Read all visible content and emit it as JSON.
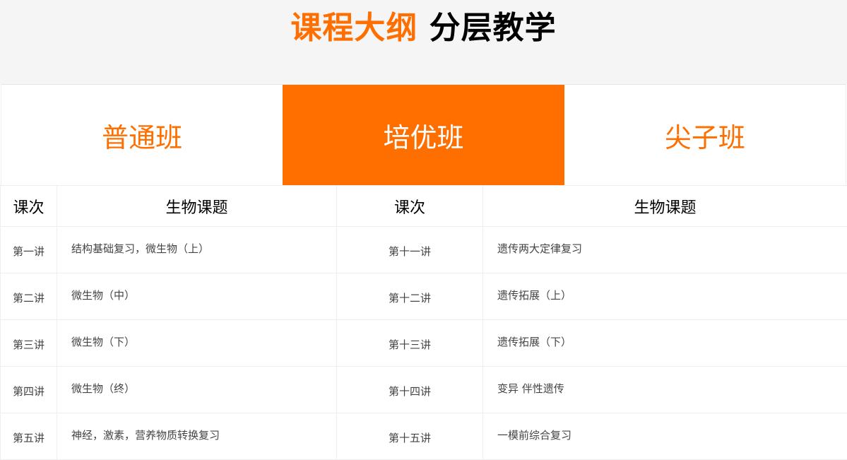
{
  "header": {
    "title_accent": "课程大纲",
    "title_rest": "分层教学"
  },
  "tabs": [
    {
      "label": "普通班",
      "active": false
    },
    {
      "label": "培优班",
      "active": true
    },
    {
      "label": "尖子班",
      "active": false
    }
  ],
  "colors": {
    "accent": "#ff6f00",
    "header_bg": "#f5f5f5"
  },
  "table": {
    "headers": [
      "课次",
      "生物课题",
      "课次",
      "生物课题"
    ],
    "rows": [
      {
        "lesson_left": "第一讲",
        "topic_left": "结构基础复习，微生物（上）",
        "lesson_right": "第十一讲",
        "topic_right": "遗传两大定律复习"
      },
      {
        "lesson_left": "第二讲",
        "topic_left": "微生物（中）",
        "lesson_right": "第十二讲",
        "topic_right": "遗传拓展（上）"
      },
      {
        "lesson_left": "第三讲",
        "topic_left": "微生物（下）",
        "lesson_right": "第十三讲",
        "topic_right": "遗传拓展（下）"
      },
      {
        "lesson_left": "第四讲",
        "topic_left": "微生物（终）",
        "lesson_right": "第十四讲",
        "topic_right": "变异 伴性遗传"
      },
      {
        "lesson_left": "第五讲",
        "topic_left": "神经，激素，营养物质转换复习",
        "lesson_right": "第十五讲",
        "topic_right": "一模前综合复习"
      }
    ]
  }
}
